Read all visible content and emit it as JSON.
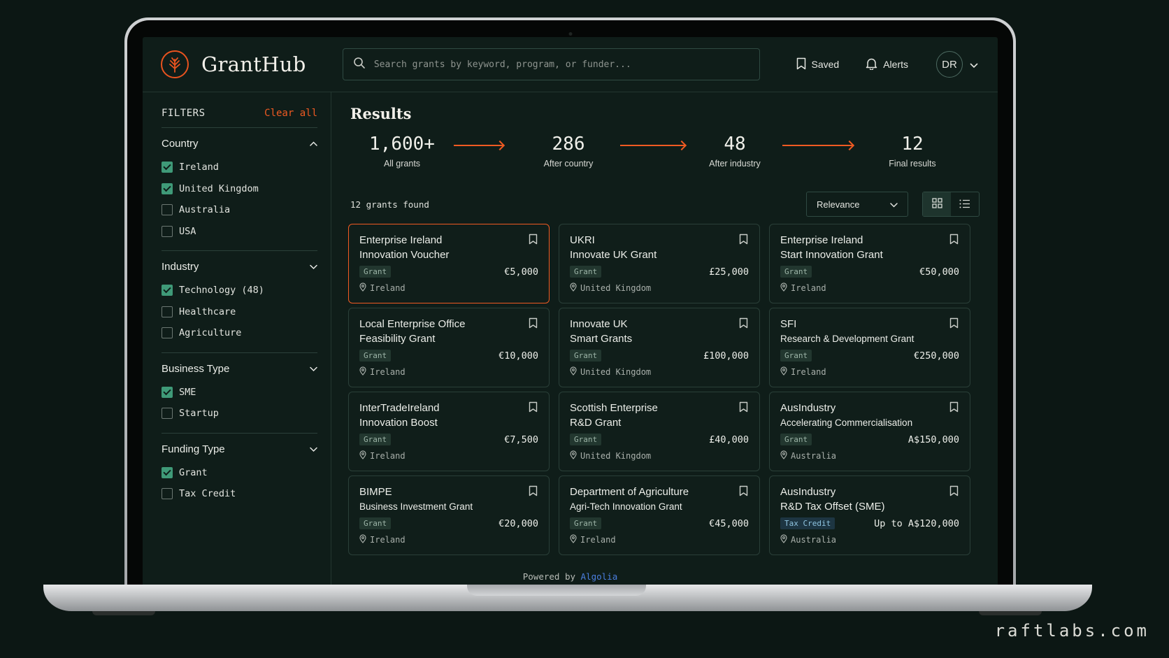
{
  "app": {
    "name": "GrantHub"
  },
  "search": {
    "placeholder": "Search grants by keyword, program, or funder..."
  },
  "header": {
    "saved_label": "Saved",
    "alerts_label": "Alerts",
    "avatar_initials": "DR"
  },
  "sidebar": {
    "title": "FILTERS",
    "clear_label": "Clear all",
    "groups": [
      {
        "title": "Country",
        "expanded": true,
        "options": [
          {
            "label": "Ireland",
            "checked": true
          },
          {
            "label": "United Kingdom",
            "checked": true
          },
          {
            "label": "Australia",
            "checked": false
          },
          {
            "label": "USA",
            "checked": false
          }
        ]
      },
      {
        "title": "Industry",
        "expanded": false,
        "options": [
          {
            "label": "Technology (48)",
            "checked": true
          },
          {
            "label": "Healthcare",
            "checked": false
          },
          {
            "label": "Agriculture",
            "checked": false
          }
        ]
      },
      {
        "title": "Business Type",
        "expanded": false,
        "options": [
          {
            "label": "SME",
            "checked": true
          },
          {
            "label": "Startup",
            "checked": false
          }
        ]
      },
      {
        "title": "Funding Type",
        "expanded": false,
        "options": [
          {
            "label": "Grant",
            "checked": true
          },
          {
            "label": "Tax Credit",
            "checked": false
          }
        ]
      }
    ]
  },
  "main": {
    "title": "Results",
    "funnel": [
      {
        "value": "1,600+",
        "label": "All grants"
      },
      {
        "value": "286",
        "label": "After country"
      },
      {
        "value": "48",
        "label": "After industry"
      },
      {
        "value": "12",
        "label": "Final results"
      }
    ],
    "count_text": "12 grants found",
    "sort_value": "Relevance",
    "view_mode": "grid"
  },
  "cards": [
    {
      "title": "Enterprise Ireland",
      "subtitle": "Innovation Voucher",
      "sub_small": false,
      "tag": "Grant",
      "amount": "€5,000",
      "location": "Ireland",
      "selected": true
    },
    {
      "title": "UKRI",
      "subtitle": "Innovate UK Grant",
      "sub_small": false,
      "tag": "Grant",
      "amount": "£25,000",
      "location": "United Kingdom"
    },
    {
      "title": "Enterprise Ireland",
      "subtitle": "Start Innovation Grant",
      "sub_small": false,
      "tag": "Grant",
      "amount": "€50,000",
      "location": "Ireland"
    },
    {
      "title": "Local Enterprise Office",
      "subtitle": "Feasibility Grant",
      "sub_small": false,
      "tag": "Grant",
      "amount": "€10,000",
      "location": "Ireland"
    },
    {
      "title": "Innovate UK",
      "subtitle": "Smart Grants",
      "sub_small": false,
      "tag": "Grant",
      "amount": "£100,000",
      "location": "United Kingdom"
    },
    {
      "title": "SFI",
      "subtitle": "Research & Development Grant",
      "sub_small": true,
      "tag": "Grant",
      "amount": "€250,000",
      "location": "Ireland"
    },
    {
      "title": "InterTradeIreland",
      "subtitle": "Innovation Boost",
      "sub_small": false,
      "tag": "Grant",
      "amount": "€7,500",
      "location": "Ireland"
    },
    {
      "title": "Scottish Enterprise",
      "subtitle": "R&D Grant",
      "sub_small": false,
      "tag": "Grant",
      "amount": "£40,000",
      "location": "United Kingdom"
    },
    {
      "title": "AusIndustry",
      "subtitle": "Accelerating Commercialisation",
      "sub_small": true,
      "tag": "Grant",
      "amount": "A$150,000",
      "location": "Australia"
    },
    {
      "title": "BIMPE",
      "subtitle": "Business Investment Grant",
      "sub_small": true,
      "tag": "Grant",
      "amount": "€20,000",
      "location": "Ireland"
    },
    {
      "title": "Department of Agriculture",
      "subtitle": "Agri-Tech Innovation Grant",
      "sub_small": true,
      "tag": "Grant",
      "amount": "€45,000",
      "location": "Ireland"
    },
    {
      "title": "AusIndustry",
      "subtitle": "R&D Tax Offset (SME)",
      "sub_small": false,
      "tag": "Tax Credit",
      "amount": "Up to A$120,000",
      "location": "Australia"
    }
  ],
  "footer": {
    "powered_prefix": "Powered by",
    "powered_brand": "Algolia"
  },
  "watermark": "raftlabs.com",
  "colors": {
    "accent": "#ef5a22",
    "background": "#0f1d19",
    "checkbox": "#3f9a78",
    "link": "#4b7fe0"
  }
}
